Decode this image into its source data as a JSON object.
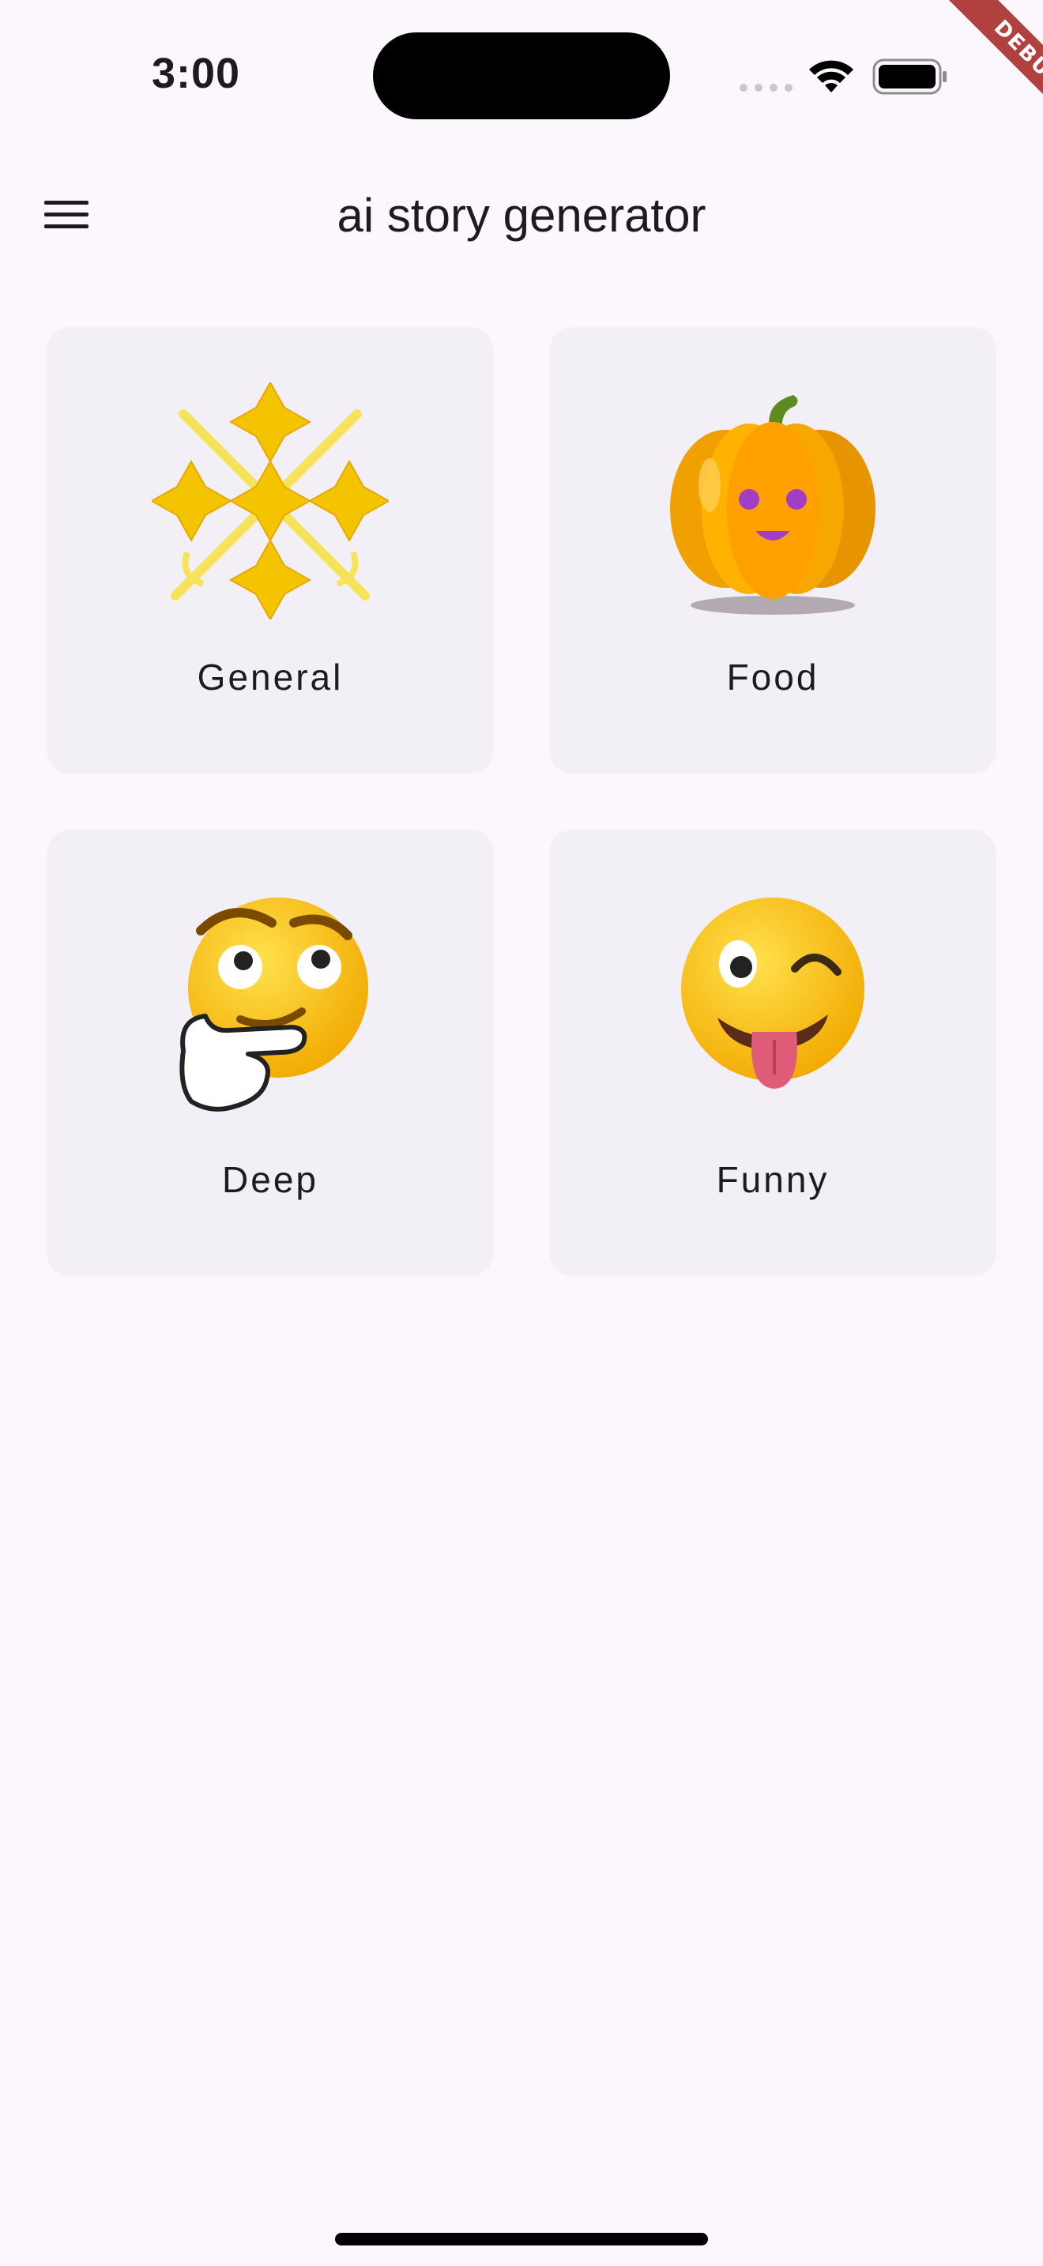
{
  "status_bar": {
    "time": "3:00",
    "icons": [
      "cellular-signal-icon",
      "wifi-icon",
      "battery-icon"
    ],
    "debug_banner": "DEBUG"
  },
  "app_bar": {
    "menu_icon": "hamburger-menu-icon",
    "title": "ai story generator"
  },
  "categories": [
    {
      "label": "General",
      "icon": "sparkles-crossed-swords-icon"
    },
    {
      "label": "Food",
      "icon": "pumpkin-face-icon"
    },
    {
      "label": "Deep",
      "icon": "thinking-face-icon"
    },
    {
      "label": "Funny",
      "icon": "winking-tongue-face-icon"
    }
  ],
  "colors": {
    "background": "#fcf7fd",
    "card": "#f3eff6",
    "text": "#1d1b20",
    "debug_ribbon": "#b0413e"
  }
}
